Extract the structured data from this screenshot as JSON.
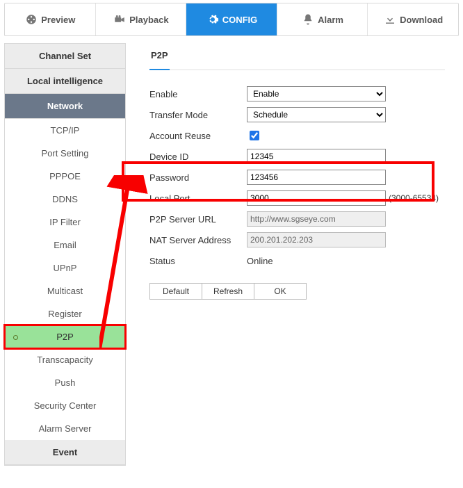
{
  "tabs": {
    "preview": "Preview",
    "playback": "Playback",
    "config": "CONFIG",
    "alarm": "Alarm",
    "download": "Download"
  },
  "sidebar": {
    "channel_set": "Channel Set",
    "local_intel": "Local intelligence",
    "network": "Network",
    "event": "Event",
    "items": [
      {
        "label": "TCP/IP"
      },
      {
        "label": "Port Setting"
      },
      {
        "label": "PPPOE"
      },
      {
        "label": "DDNS"
      },
      {
        "label": "IP Filter"
      },
      {
        "label": "Email"
      },
      {
        "label": "UPnP"
      },
      {
        "label": "Multicast"
      },
      {
        "label": "Register"
      },
      {
        "label": "P2P"
      },
      {
        "label": "Transcapacity"
      },
      {
        "label": "Push"
      },
      {
        "label": "Security Center"
      },
      {
        "label": "Alarm Server"
      }
    ]
  },
  "page": {
    "title": "P2P",
    "labels": {
      "enable": "Enable",
      "transfer": "Transfer Mode",
      "account_reuse": "Account Reuse",
      "device_id": "Device ID",
      "password": "Password",
      "local_port": "Local Port",
      "p2p_url": "P2P Server URL",
      "nat": "NAT Server Address",
      "status": "Status"
    },
    "values": {
      "enable": "Enable",
      "transfer": "Schedule",
      "account_reuse": true,
      "device_id": "12345",
      "password": "123456",
      "local_port": "3000",
      "local_port_hint": "(3000-65534)",
      "p2p_url": "http://www.sgseye.com",
      "nat": "200.201.202.203",
      "status": "Online"
    },
    "buttons": {
      "default": "Default",
      "refresh": "Refresh",
      "ok": "OK"
    }
  }
}
